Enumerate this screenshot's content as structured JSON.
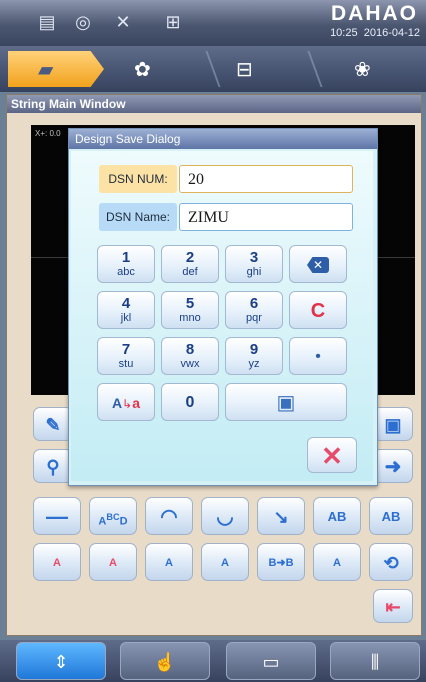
{
  "header": {
    "brand": "DAHAO",
    "time": "10:25",
    "date": "2016-04-12",
    "status_icons": [
      "pattern-icon",
      "speed-icon",
      "needle-icon",
      "spindle-icon"
    ]
  },
  "tabs": [
    {
      "name": "folder-tab",
      "icon": "folder-icon",
      "active": true
    },
    {
      "name": "edit-tab",
      "icon": "flower-edit-icon",
      "active": false
    },
    {
      "name": "frame-tab",
      "icon": "frame-icon",
      "active": false
    },
    {
      "name": "embroider-tab",
      "icon": "embroider-icon",
      "active": false
    }
  ],
  "window": {
    "title": "String Main Window",
    "coord": "X+: 0.0"
  },
  "dialog": {
    "title": "Design Save Dialog",
    "num_label": "DSN NUM:",
    "num_value": "20",
    "name_label": "DSN Name:",
    "name_value": "ZIMU",
    "keys": [
      {
        "digit": "1",
        "letters": "abc"
      },
      {
        "digit": "2",
        "letters": "def"
      },
      {
        "digit": "3",
        "letters": "ghi"
      },
      {
        "digit": "4",
        "letters": "jkl"
      },
      {
        "digit": "5",
        "letters": "mno"
      },
      {
        "digit": "6",
        "letters": "pqr"
      },
      {
        "digit": "7",
        "letters": "stu"
      },
      {
        "digit": "8",
        "letters": "vwx"
      },
      {
        "digit": "9",
        "letters": "yz"
      },
      {
        "digit": "0",
        "letters": ""
      }
    ],
    "backspace_icon": "backspace-icon",
    "clear_label": "C",
    "dot_label": "•",
    "case_label": "A",
    "case_sub": "a",
    "save_icon": "floppy-icon",
    "cancel_icon": "x-icon"
  },
  "toolbar": {
    "bc_label": "BC",
    "a_label": "A",
    "d_label": "D",
    "ab_label": "AB",
    "a_small": "A",
    "b_to_b": "B➜B"
  },
  "colors": {
    "accent_orange": "#f2a21c",
    "tab_active": "#ffd27a",
    "dialog_bg": "#d7f2f7",
    "cancel_red": "#e84a6a",
    "clear_red": "#e0324a"
  }
}
